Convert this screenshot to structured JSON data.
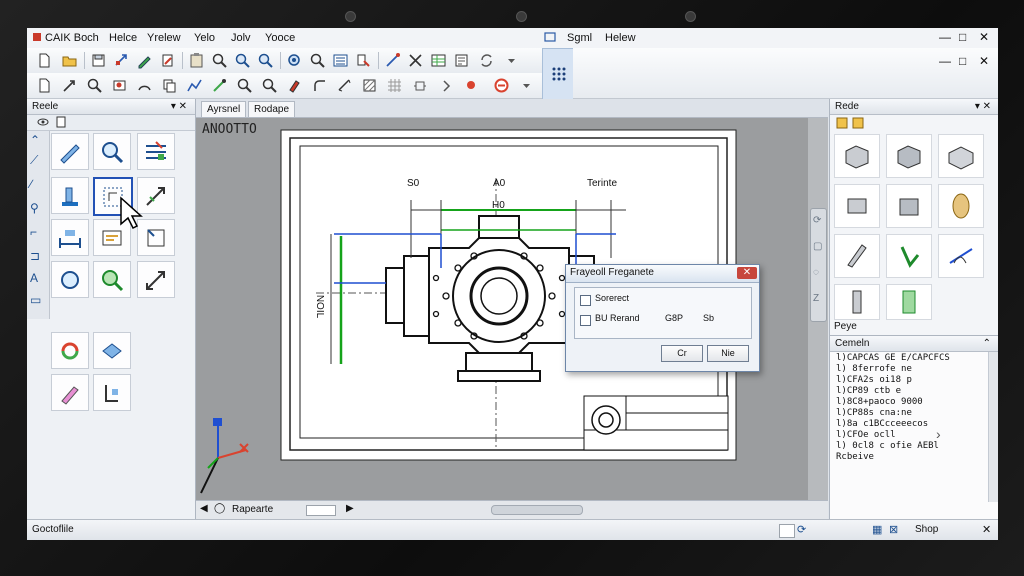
{
  "window": {
    "app_title": "CAIK Boch",
    "menus": [
      "Helce",
      "Yrelew",
      "Yelo",
      "Jolv",
      "Yooce"
    ],
    "menus_right": [
      "Sgml",
      "Helew"
    ],
    "controls": [
      "—",
      "□",
      "✕"
    ],
    "controls2": [
      "—",
      "□",
      "✕"
    ]
  },
  "left_panel": {
    "title": "Reele",
    "controls": "▾ ✕"
  },
  "tabs": [
    {
      "label": "Ayrsnel"
    },
    {
      "label": "Rodape"
    }
  ],
  "drawing": {
    "sheet_label": "ANOOTTO",
    "dims": {
      "d1": "S0",
      "d2": "A0",
      "d3": "H0",
      "d4": "Terinte",
      "v1": "NOIL"
    }
  },
  "dialog": {
    "title": "Frayeoll Freganete",
    "close": "✕",
    "option1": "Sorerect",
    "option2": "BU Rerand",
    "val1": "G8P",
    "val2": "Sb",
    "ok": "Cr",
    "cancel": "Nie"
  },
  "canvas_bar": {
    "label": "Rapearte"
  },
  "right_panel": {
    "title": "Rede",
    "controls": "▾ ✕",
    "footer": "Peye"
  },
  "command_panel": {
    "title": "Cemeln",
    "lines": [
      "l)CAPCAS GE E/CAPCFCS",
      "l) 8ferrofe ne",
      "l)CFA2s oi18 p",
      "l)CP89 ctb e",
      "l)8C8+paoco 9000",
      "l)CP88s cna:ne",
      "l)8a c1BCcceeecos",
      "l)CFOe ocll",
      "l) 0cl8 c ofie AEBl",
      "Rcbeive"
    ]
  },
  "status": {
    "left": "Goctoflile",
    "right": "Shop"
  },
  "colors": {
    "dim_green": "#15a31a",
    "dim_blue": "#1f4fd1",
    "select_blue": "#2251b5"
  }
}
